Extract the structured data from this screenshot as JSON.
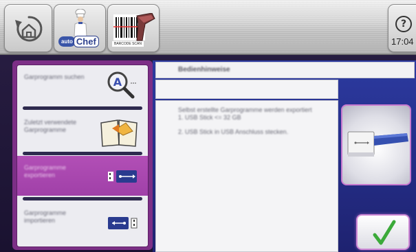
{
  "topbar": {
    "home_icon": "home-back-icon",
    "autochef": {
      "figure_icon": "chef-figure-icon",
      "logo_auto": "auto",
      "logo_chef": "Chef"
    },
    "barcode": {
      "icon": "barcode-scanner-icon",
      "caption": "BARCODE SCAN"
    },
    "help": {
      "symbol": "?",
      "clock": "17:04"
    }
  },
  "menu": {
    "items": [
      {
        "label": "Garprogramm suchen",
        "icon": "search-icon",
        "active": false
      },
      {
        "label": "Zuletzt verwendete Garprogramme",
        "icon": "book-icon",
        "active": false
      },
      {
        "label": "Garprogramme exportieren",
        "icon": "usb-export-icon",
        "active": true
      },
      {
        "label": "Garprogramme importieren",
        "icon": "usb-import-icon",
        "active": false
      }
    ]
  },
  "content": {
    "header": "Bedienhinweise",
    "body_paragraphs": [
      "Selbst erstellte Garprogramme werden exportiert\n1. USB Stick <= 32 GB",
      "2. USB Stick in USB Anschluss stecken."
    ],
    "preview_icon": "usb-stick-icon",
    "confirm_icon": "checkmark-icon"
  },
  "colors": {
    "accent_purple": "#7c2f86",
    "active_item": "#b24fb6",
    "content_blue": "#2c3aa0",
    "check_green": "#3caa3a"
  }
}
